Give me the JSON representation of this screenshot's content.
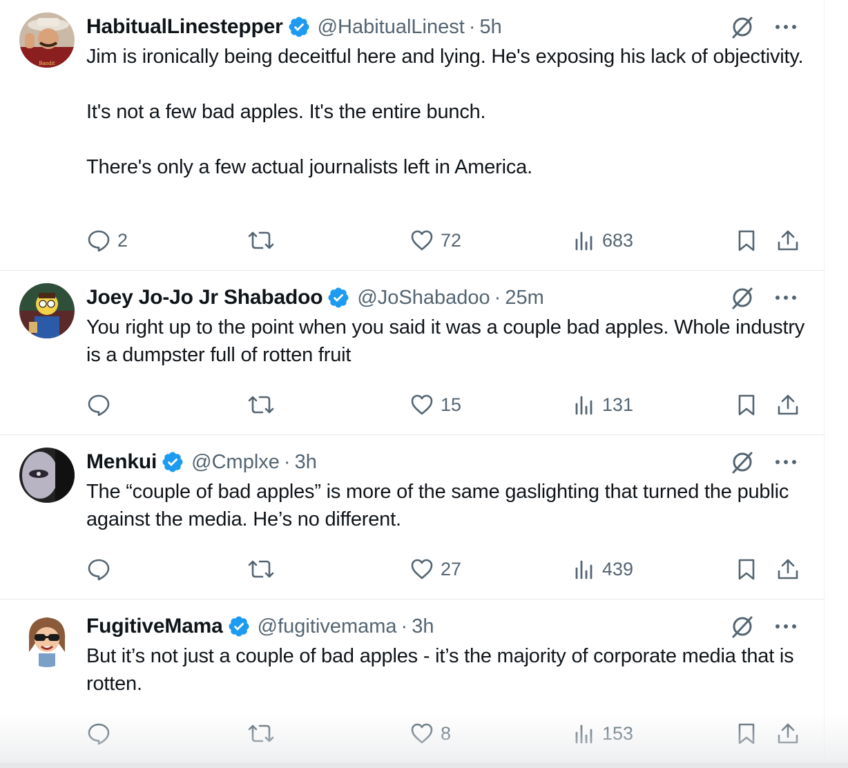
{
  "tweets": [
    {
      "name": "HabitualLinestepper",
      "handle": "@HabitualLinest",
      "dot": "·",
      "time": "5h",
      "paragraphs": [
        "Jim is ironically being deceitful here and lying. He's exposing his lack of objectivity.",
        "It's not a few bad apples. It's the entire bunch.",
        "There's only a few actual journalists left in America."
      ],
      "replies": "2",
      "reposts": "",
      "likes": "72",
      "views": "683"
    },
    {
      "name": "Joey Jo-Jo Jr Shabadoo",
      "handle": "@JoShabadoo",
      "dot": "·",
      "time": "25m",
      "paragraphs": [
        "You right up to the point when you said it was a couple bad apples. Whole industry is a dumpster full of rotten fruit"
      ],
      "replies": "",
      "reposts": "",
      "likes": "15",
      "views": "131"
    },
    {
      "name": "Menkui",
      "handle": "@Cmplxe",
      "dot": "·",
      "time": "3h",
      "paragraphs": [
        "The “couple of bad apples” is more of the same gaslighting that turned the public against the media. He’s no different."
      ],
      "replies": "",
      "reposts": "",
      "likes": "27",
      "views": "439"
    },
    {
      "name": "FugitiveMama",
      "handle": "@fugitivemama",
      "dot": "·",
      "time": "3h",
      "paragraphs": [
        "But it’s not just a couple of bad apples - it’s the majority of corporate media that is rotten."
      ],
      "replies": "",
      "reposts": "",
      "likes": "8",
      "views": "153"
    }
  ],
  "colors": {
    "text": "#0f1419",
    "secondary": "#536471",
    "verified": "#1d9bf0",
    "divider": "#e7e9ea"
  },
  "icons": [
    "verified-badge-icon",
    "grok-icon",
    "more-icon",
    "reply-icon",
    "repost-icon",
    "like-icon",
    "views-icon",
    "bookmark-icon",
    "share-icon"
  ]
}
